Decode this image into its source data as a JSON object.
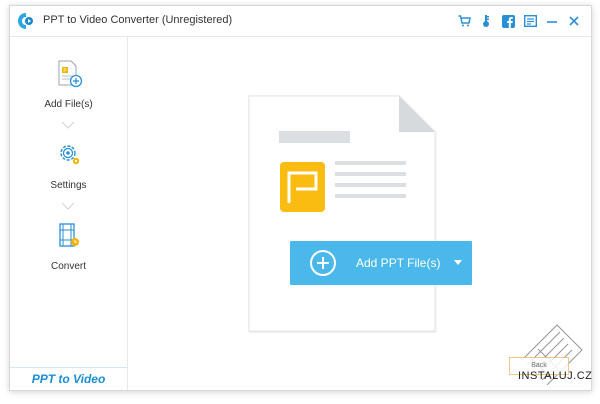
{
  "window": {
    "title": "PPT to Video Converter (Unregistered)",
    "accent": "#4bb8ec",
    "toolbar_icons": [
      "cart-icon",
      "key-icon",
      "facebook-icon",
      "feedback-icon",
      "minimize-icon",
      "close-icon"
    ]
  },
  "sidebar": {
    "items": [
      {
        "label": "Add File(s)",
        "icon": "add-file-icon"
      },
      {
        "label": "Settings",
        "icon": "settings-gear-icon"
      },
      {
        "label": "Convert",
        "icon": "convert-film-icon"
      }
    ],
    "brand": "PPT to Video"
  },
  "main": {
    "add_button": {
      "label": "Add PPT File(s)"
    }
  },
  "overlay": {
    "back_label": "Back",
    "watermark": "INSTALUJ.CZ"
  }
}
